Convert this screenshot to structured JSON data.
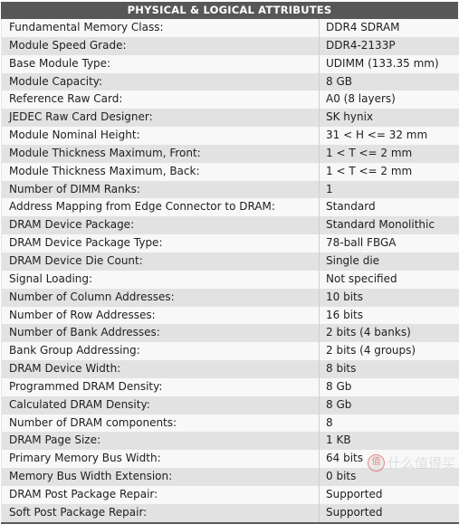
{
  "panel": {
    "section_title": "PHYSICAL & LOGICAL ATTRIBUTES",
    "header_bg": "#575857",
    "header_text_color": "#ffffff",
    "row_odd_bg": "#f8f8f8",
    "row_even_bg": "#e2e2e2",
    "text_color": "#1e1e1e",
    "divider_color": "#cfcfcf"
  },
  "rows": [
    {
      "key": "Fundamental Memory Class:",
      "value": "DDR4 SDRAM"
    },
    {
      "key": "Module Speed Grade:",
      "value": "DDR4-2133P"
    },
    {
      "key": "Base Module Type:",
      "value": "UDIMM (133.35 mm)"
    },
    {
      "key": "Module Capacity:",
      "value": "8 GB"
    },
    {
      "key": "Reference Raw Card:",
      "value": "A0 (8 layers)"
    },
    {
      "key": "JEDEC Raw Card Designer:",
      "value": "SK hynix"
    },
    {
      "key": "Module Nominal Height:",
      "value": "31 < H <= 32 mm"
    },
    {
      "key": "Module Thickness Maximum, Front:",
      "value": "1 < T <= 2 mm"
    },
    {
      "key": "Module Thickness Maximum, Back:",
      "value": "1 < T <= 2 mm"
    },
    {
      "key": "Number of DIMM Ranks:",
      "value": "1"
    },
    {
      "key": "Address Mapping from Edge Connector to DRAM:",
      "value": "Standard"
    },
    {
      "key": "DRAM Device Package:",
      "value": "Standard Monolithic"
    },
    {
      "key": "DRAM Device Package Type:",
      "value": "78-ball FBGA"
    },
    {
      "key": "DRAM Device Die Count:",
      "value": "Single die"
    },
    {
      "key": "Signal Loading:",
      "value": "Not specified"
    },
    {
      "key": "Number of Column Addresses:",
      "value": "10 bits"
    },
    {
      "key": "Number of Row Addresses:",
      "value": "16 bits"
    },
    {
      "key": "Number of Bank Addresses:",
      "value": "2 bits (4 banks)"
    },
    {
      "key": "Bank Group Addressing:",
      "value": "2 bits (4 groups)"
    },
    {
      "key": "DRAM Device Width:",
      "value": "8 bits"
    },
    {
      "key": "Programmed DRAM Density:",
      "value": "8 Gb"
    },
    {
      "key": "Calculated DRAM Density:",
      "value": "8 Gb"
    },
    {
      "key": "Number of DRAM components:",
      "value": "8"
    },
    {
      "key": "DRAM Page Size:",
      "value": "1 KB"
    },
    {
      "key": "Primary Memory Bus Width:",
      "value": "64 bits"
    },
    {
      "key": "Memory Bus Width Extension:",
      "value": "0 bits"
    },
    {
      "key": "DRAM Post Package Repair:",
      "value": "Supported"
    },
    {
      "key": "Soft Post Package Repair:",
      "value": "Supported"
    }
  ],
  "watermark": {
    "badge": "值",
    "text": "什么值得买",
    "color": "#cfcfcf",
    "badge_color": "#d8453c"
  }
}
